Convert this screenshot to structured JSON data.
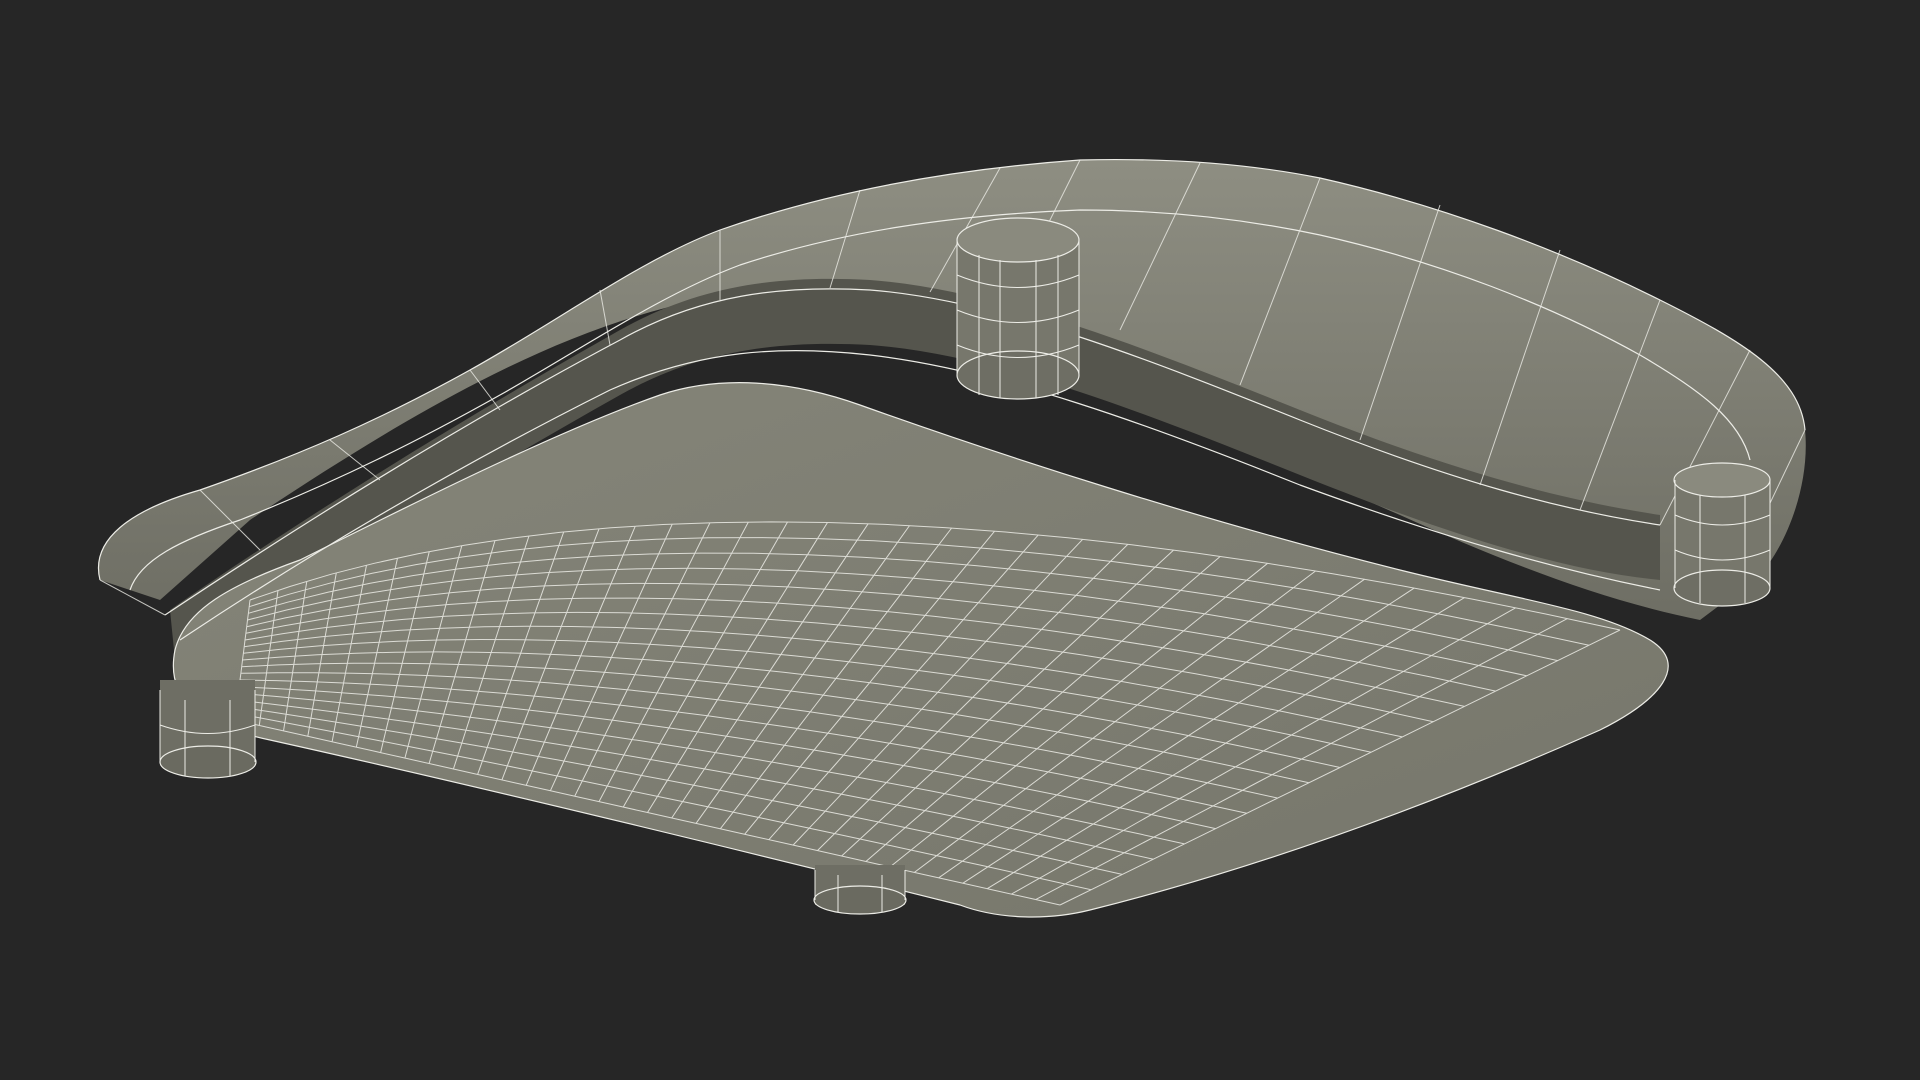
{
  "colors": {
    "background": "#262626",
    "mesh_body": "#7e7e72",
    "mesh_body_dark": "#66665c",
    "mesh_shadow": "#4f4f47",
    "mesh_rim": "#8a8a7e",
    "wire": "#ecece6"
  }
}
